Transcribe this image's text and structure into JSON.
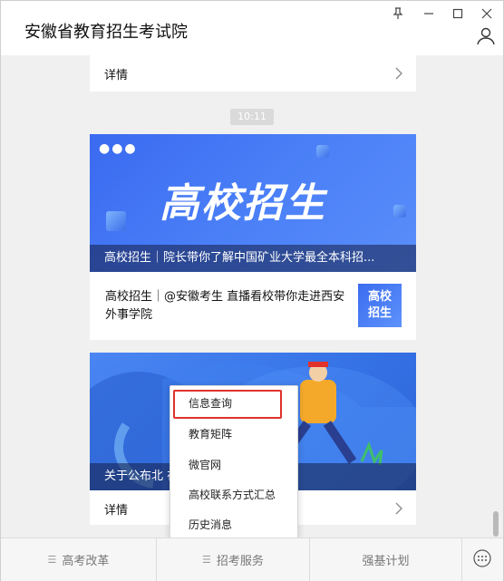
{
  "window": {
    "title": "安徽省教育招生考试院",
    "pin_icon": "pin-icon",
    "minimize_icon": "minimize-icon",
    "maximize_icon": "maximize-icon",
    "close_icon": "close-icon",
    "profile_icon": "user-icon"
  },
  "feed": {
    "card1": {
      "detail_label": "详情"
    },
    "timestamp": "10:11",
    "card2": {
      "banner_text": "高校招生",
      "banner_caption": "高校招生｜院长带你了解中国矿业大学最全本科招...",
      "sub_title": "高校招生｜@安徽考生 直播看校带你走进西安外事学院",
      "thumb_text_line1": "高校",
      "thumb_text_line2": "招生"
    },
    "card3": {
      "banner_caption": "关于公布北 在皖招生面试分...",
      "detail_label": "详情"
    }
  },
  "popup_menu": {
    "items": [
      "信息查询",
      "教育矩阵",
      "微官网",
      "高校联系方式汇总",
      "历史消息"
    ],
    "highlighted_index": 0
  },
  "bottom_menu": {
    "tabs": [
      "高考改革",
      "招考服务",
      "强基计划"
    ],
    "keyboard_icon": "keyboard-icon"
  },
  "colors": {
    "accent_blue": "#3b6cf0",
    "highlight_red": "#e0322b"
  }
}
